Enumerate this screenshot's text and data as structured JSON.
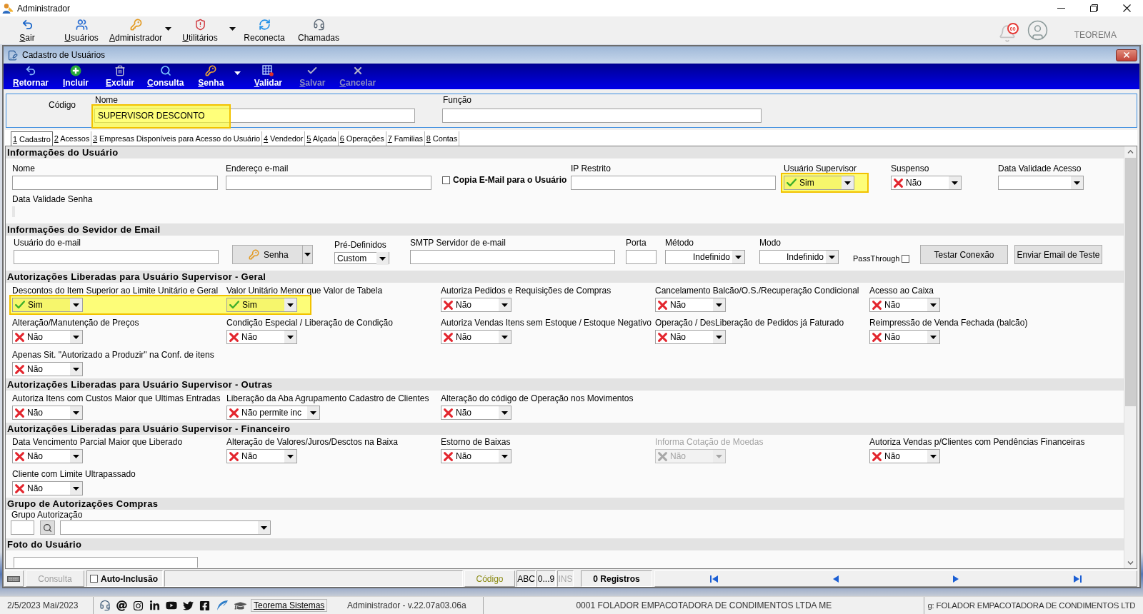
{
  "window": {
    "title": "Administrador"
  },
  "main_toolbar": {
    "items": [
      {
        "label": "Sair",
        "mnemonic": true,
        "has_menu": false
      },
      {
        "label": "Usuários",
        "mnemonic": true,
        "has_menu": false
      },
      {
        "label": "Administrador",
        "mnemonic": true,
        "has_menu": true
      },
      {
        "label": "Utilitários",
        "mnemonic": true,
        "has_menu": true
      },
      {
        "label": "Reconecta",
        "mnemonic": false,
        "has_menu": false
      },
      {
        "label": "Chamadas",
        "mnemonic": false,
        "has_menu": false
      }
    ],
    "notification_count": "00",
    "user_name": "TEOREMA"
  },
  "child_window": {
    "title": "Cadastro de Usuários",
    "toolbar": [
      {
        "label": "Retornar",
        "disabled": false,
        "has_menu": false
      },
      {
        "label": "Incluir",
        "disabled": false,
        "has_menu": false
      },
      {
        "label": "Excluir",
        "disabled": false,
        "has_menu": false
      },
      {
        "label": "Consulta",
        "disabled": false,
        "has_menu": false
      },
      {
        "label": "Senha",
        "disabled": false,
        "has_menu": true
      },
      {
        "label": "Validar",
        "disabled": false,
        "has_menu": false
      },
      {
        "label": "Salvar",
        "disabled": true,
        "has_menu": false
      },
      {
        "label": "Cancelar",
        "disabled": true,
        "has_menu": false
      }
    ],
    "header": {
      "code_label": "Código",
      "name_label": "Nome",
      "name_value": "SUPERVISOR DESCONTO",
      "name_highlighted": true,
      "function_label": "Função"
    },
    "tabs": [
      {
        "label": "1 Cadastro",
        "selected": true
      },
      {
        "label": "2 Acessos",
        "selected": false
      },
      {
        "label": "3 Empresas Disponíveis para Acesso do Usuário",
        "selected": false
      },
      {
        "label": "4 Vendedor",
        "selected": false
      },
      {
        "label": "5 Alçada",
        "selected": false
      },
      {
        "label": "6 Operações",
        "selected": false
      },
      {
        "label": "7 Familias",
        "selected": false
      },
      {
        "label": "8 Contas",
        "selected": false
      }
    ],
    "sections": [
      {
        "title": "Informações do Usuário",
        "rows": [
          [
            {
              "kind": "text",
              "label": "Nome"
            },
            {
              "kind": "text",
              "label": "Endereço e-mail"
            },
            {
              "kind": "checkbox",
              "label": "Copia E-Mail para o Usuário",
              "checked": false
            },
            {
              "kind": "text",
              "label": "IP Restrito"
            },
            {
              "kind": "combo",
              "label": "Usuário Supervisor",
              "value": "Sim",
              "allowed": true,
              "highlighted": true,
              "disabled": false
            },
            {
              "kind": "combo",
              "label": "Suspenso",
              "value": "Não",
              "allowed": false,
              "highlighted": false,
              "disabled": false
            },
            {
              "kind": "select",
              "label": "Data Validade Acesso"
            }
          ],
          [
            {
              "kind": "date",
              "label": "Data Validade Senha"
            }
          ]
        ]
      },
      {
        "title": "Informações do Sevidor de Email",
        "rows": [
          [
            {
              "kind": "text",
              "label": "Usuário do e-mail"
            },
            {
              "kind": "split-button",
              "label": "Senha"
            },
            {
              "kind": "select",
              "label": "Pré-Definidos",
              "value": "Custom"
            },
            {
              "kind": "text",
              "label": "SMTP Servidor de e-mail"
            },
            {
              "kind": "text",
              "label": "Porta"
            },
            {
              "kind": "select",
              "label": "Método",
              "value": "Indefinido"
            },
            {
              "kind": "select",
              "label": "Modo",
              "value": "Indefinido"
            },
            {
              "kind": "checkbox-after",
              "label": "PassThrough",
              "checked": false
            },
            {
              "kind": "button",
              "label": "Testar Conexão"
            },
            {
              "kind": "button",
              "label": "Enviar Email de Teste"
            }
          ]
        ]
      },
      {
        "title": "Autorizações Liberadas para Usuário Supervisor - Geral",
        "rows": [
          [
            {
              "kind": "combo",
              "label": "Descontos do Item Superior ao Limite Unitário e Geral",
              "value": "Sim",
              "allowed": true,
              "highlighted": true,
              "disabled": false
            },
            {
              "kind": "combo",
              "label": "Valor Unitário Menor que Valor de Tabela",
              "value": "Sim",
              "allowed": true,
              "highlighted": true,
              "disabled": false
            },
            {
              "kind": "combo",
              "label": "Autoriza Pedidos e Requisições de Compras",
              "value": "Não",
              "allowed": false,
              "highlighted": false,
              "disabled": false
            },
            {
              "kind": "combo",
              "label": "Cancelamento Balcão/O.S./Recuperação Condicional",
              "value": "Não",
              "allowed": false,
              "highlighted": false,
              "disabled": false
            },
            {
              "kind": "combo",
              "label": "Acesso ao Caixa",
              "value": "Não",
              "allowed": false,
              "highlighted": false,
              "disabled": false
            }
          ],
          [
            {
              "kind": "combo",
              "label": "Alteração/Manutenção de Preços",
              "value": "Não",
              "allowed": false,
              "highlighted": false,
              "disabled": false
            },
            {
              "kind": "combo",
              "label": "Condição Especial / Liberação de Condição",
              "value": "Não",
              "allowed": false,
              "highlighted": false,
              "disabled": false
            },
            {
              "kind": "combo",
              "label": "Autoriza Vendas Itens sem Estoque / Estoque Negativo",
              "value": "Não",
              "allowed": false,
              "highlighted": false,
              "disabled": false
            },
            {
              "kind": "combo",
              "label": "Operação / DesLiberação de Pedidos já Faturado",
              "value": "Não",
              "allowed": false,
              "highlighted": false,
              "disabled": false
            },
            {
              "kind": "combo",
              "label": "Reimpressão de Venda Fechada (balcão)",
              "value": "Não",
              "allowed": false,
              "highlighted": false,
              "disabled": false
            }
          ],
          [
            {
              "kind": "combo",
              "label": "Apenas Sit. \"Autorizado a Produzir\" na Conf. de itens",
              "value": "Não",
              "allowed": false,
              "highlighted": false,
              "disabled": false
            }
          ]
        ]
      },
      {
        "title": "Autorizações Liberadas para Usuário Supervisor - Outras",
        "rows": [
          [
            {
              "kind": "combo",
              "label": "Autoriza Itens com Custos Maior que Ultimas Entradas",
              "value": "Não",
              "allowed": false,
              "highlighted": false,
              "disabled": false
            },
            {
              "kind": "combo",
              "label": "Liberação da Aba Agrupamento Cadastro de Clientes",
              "value": "Não permite inc",
              "allowed": false,
              "highlighted": false,
              "disabled": false
            },
            {
              "kind": "combo",
              "label": "Alteração do código de Operação nos Movimentos",
              "value": "Não",
              "allowed": false,
              "highlighted": false,
              "disabled": false
            }
          ]
        ]
      },
      {
        "title": "Autorizações Liberadas para Usuário Supervisor - Financeiro",
        "rows": [
          [
            {
              "kind": "combo",
              "label": "Data Vencimento Parcial Maior que Liberado",
              "value": "Não",
              "allowed": false,
              "highlighted": false,
              "disabled": false
            },
            {
              "kind": "combo",
              "label": "Alteração de Valores/Juros/Desctos na Baixa",
              "value": "Não",
              "allowed": false,
              "highlighted": false,
              "disabled": false
            },
            {
              "kind": "combo",
              "label": "Estorno de Baixas",
              "value": "Não",
              "allowed": false,
              "highlighted": false,
              "disabled": false
            },
            {
              "kind": "combo",
              "label": "Informa Cotação de Moedas",
              "value": "Não",
              "allowed": false,
              "highlighted": false,
              "disabled": true
            },
            {
              "kind": "combo",
              "label": "Autoriza Vendas p/Clientes com Pendências Financeiras",
              "value": "Não",
              "allowed": false,
              "highlighted": false,
              "disabled": false
            }
          ],
          [
            {
              "kind": "combo",
              "label": "Cliente com Limite Ultrapassado",
              "value": "Não",
              "allowed": false,
              "highlighted": false,
              "disabled": false
            }
          ]
        ]
      },
      {
        "title": "Grupo de Autorizações Compras",
        "rows": [
          [
            {
              "kind": "lookup",
              "label": "Grupo Autorização"
            }
          ]
        ]
      },
      {
        "title": "Foto do Usuário",
        "rows": [
          [
            {
              "kind": "photo"
            }
          ]
        ]
      }
    ],
    "status_strip": {
      "mode_button": {
        "label": "Consulta",
        "disabled": true
      },
      "auto_include": {
        "label": "Auto-Inclusão",
        "checked": false
      },
      "sort_field": "Código",
      "indicators": [
        {
          "label": "ABC",
          "disabled": false
        },
        {
          "label": "0...9",
          "disabled": false
        },
        {
          "label": "INS",
          "disabled": true
        }
      ],
      "record_count": "0 Registros"
    }
  },
  "status_bar": {
    "date": "2/5/2023 Mai/2023",
    "link": "Teorema Sistemas",
    "user_version": "Administrador - v.22.07a03.06a",
    "company": "0001 FOLADOR EMPACOTADORA DE CONDIMENTOS LTDA ME",
    "panel_6": "g: FOLADOR EMPACOTADORA DE CONDIMENTOS LTD"
  }
}
